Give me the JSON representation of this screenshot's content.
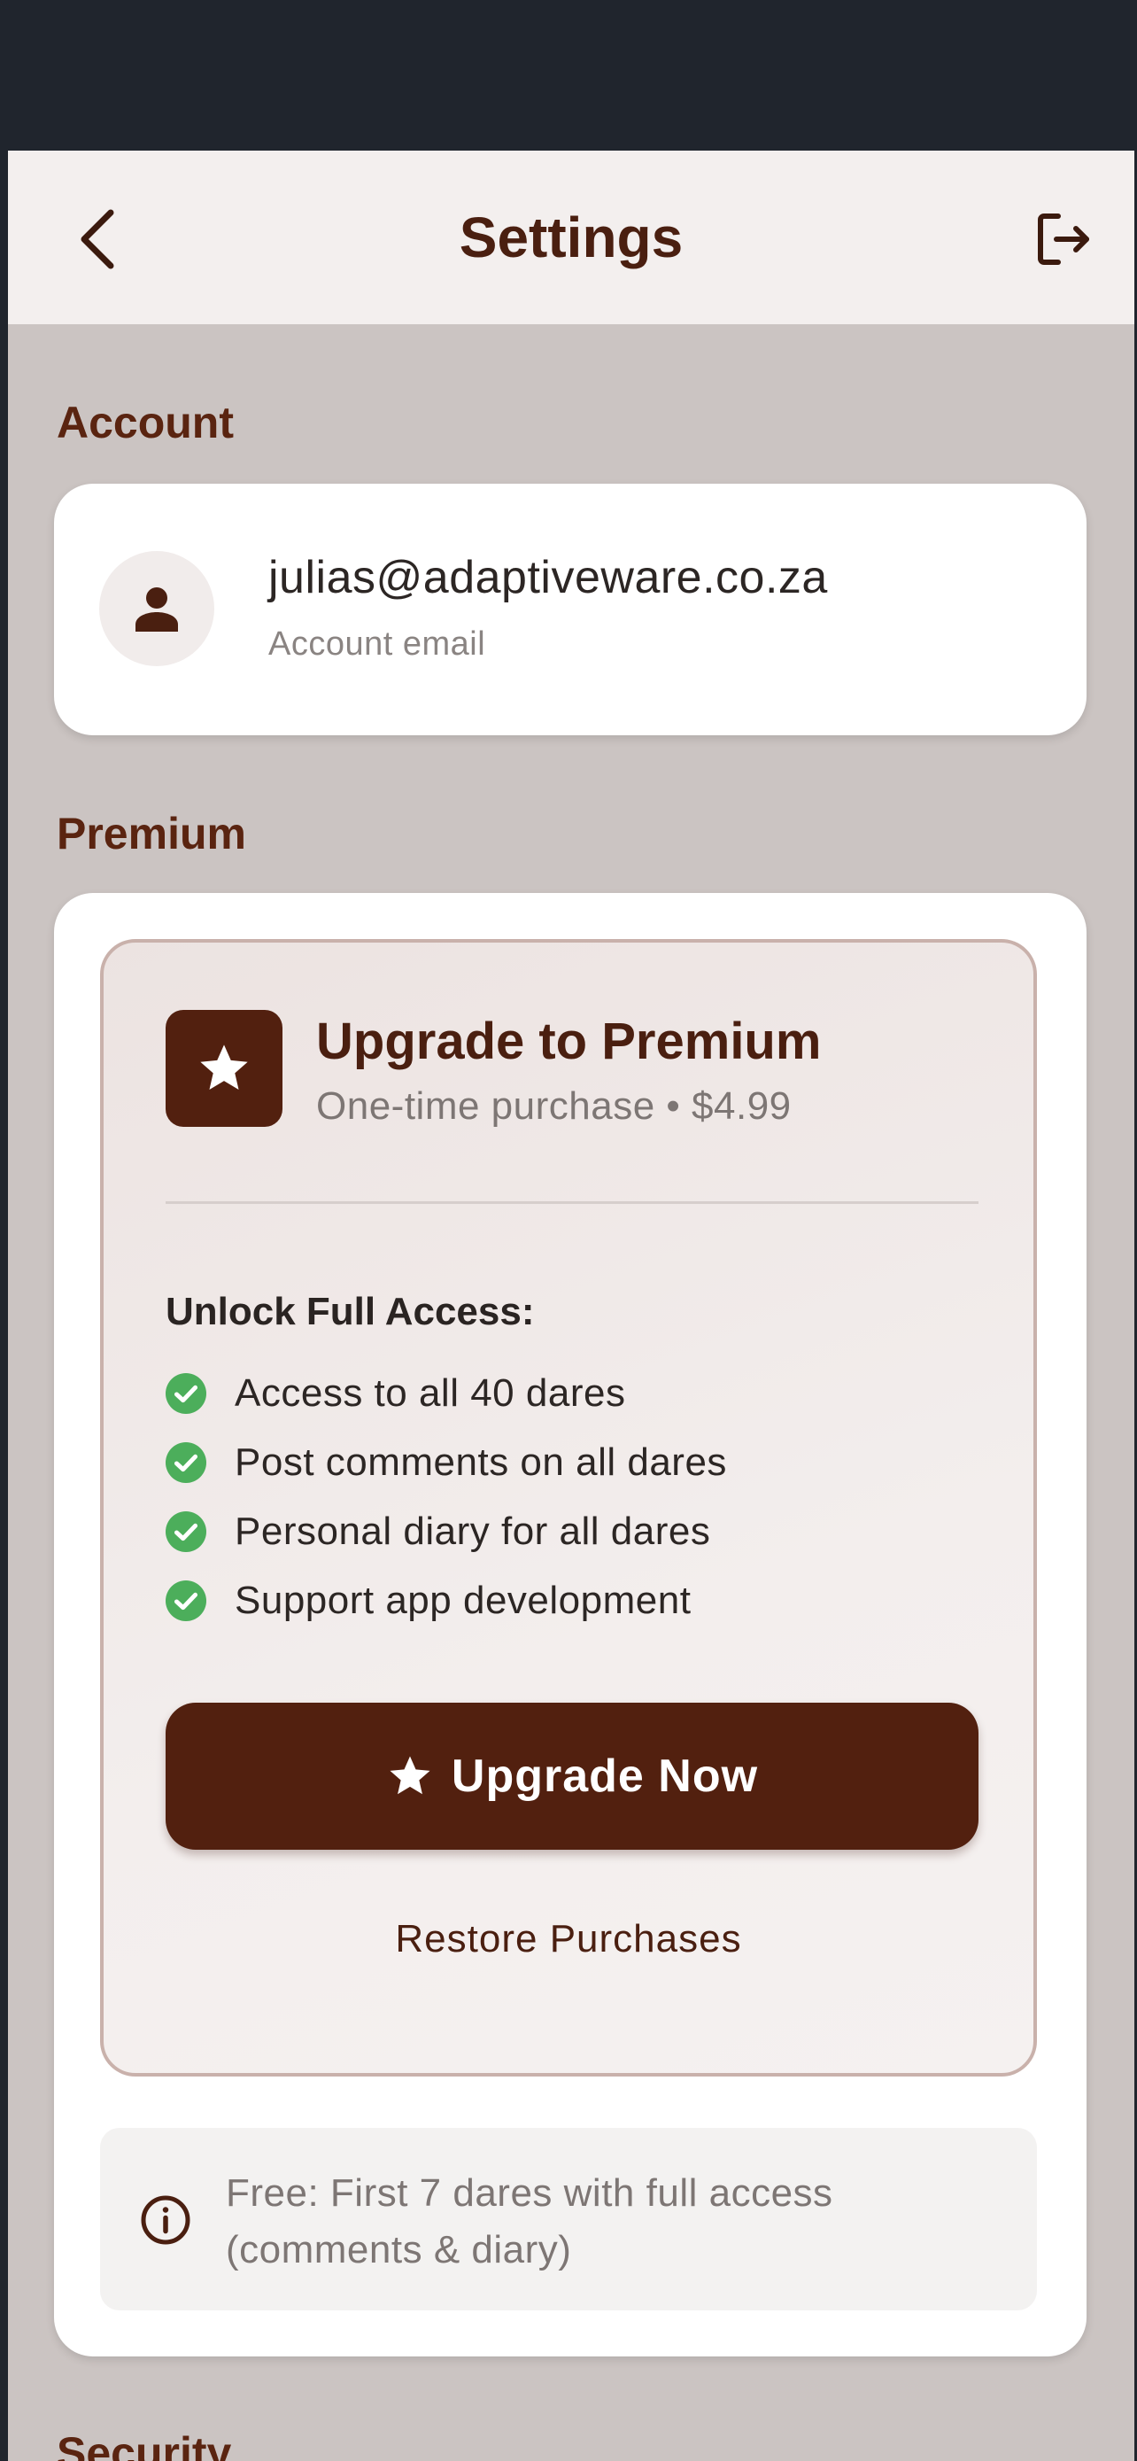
{
  "header": {
    "title": "Settings",
    "back_icon": "chevron-left-icon",
    "logout_icon": "logout-icon"
  },
  "account": {
    "section_title": "Account",
    "email": "julias@adaptiveware.co.za",
    "email_label": "Account email",
    "avatar_icon": "person-icon"
  },
  "premium": {
    "section_title": "Premium",
    "title": "Upgrade to Premium",
    "subtitle": "One-time purchase • $4.99",
    "unlock_heading": "Unlock Full Access:",
    "features": [
      "Access to all 40 dares",
      "Post comments on all dares",
      "Personal diary for all dares",
      "Support app development"
    ],
    "upgrade_button": "Upgrade Now",
    "restore_button": "Restore Purchases",
    "free_info": "Free: First 7 dares with full access (comments & diary)"
  },
  "security": {
    "section_title": "Security"
  },
  "colors": {
    "brand": "#52200f",
    "check": "#4cae5b",
    "background": "#cbc4c2"
  }
}
